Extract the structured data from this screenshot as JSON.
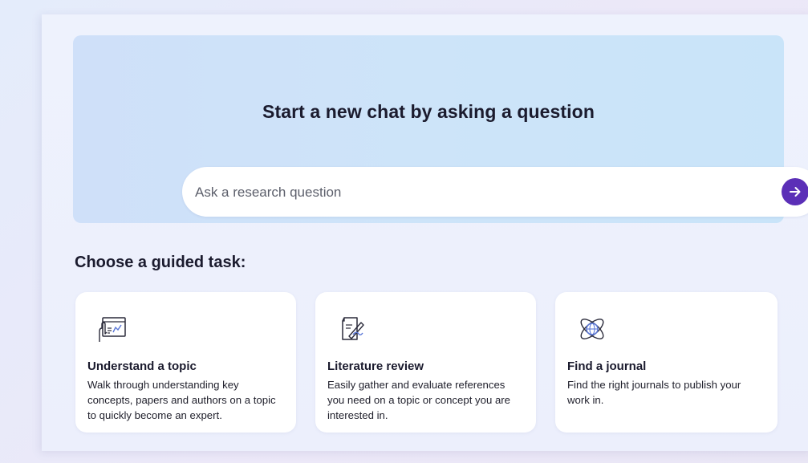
{
  "hero": {
    "title": "Start a new chat by asking a question",
    "search_placeholder": "Ask a research question"
  },
  "guided": {
    "heading": "Choose a guided task:",
    "cards": [
      {
        "title": "Understand a topic",
        "description": "Walk through understanding key concepts, papers and authors on a topic to quickly become an expert.",
        "icon": "topic-screen-hand-icon"
      },
      {
        "title": "Literature review",
        "description": "Easily gather and evaluate references you need on a topic or concept you are interested in.",
        "icon": "document-writing-icon"
      },
      {
        "title": "Find a journal",
        "description": "Find the right journals to publish your work in.",
        "icon": "globe-orbit-icon"
      }
    ]
  },
  "colors": {
    "accent": "#5b2fb7",
    "hero_bg": "#cde2f9",
    "card_bg": "#ffffff",
    "icon_accent": "#5b78d8"
  }
}
